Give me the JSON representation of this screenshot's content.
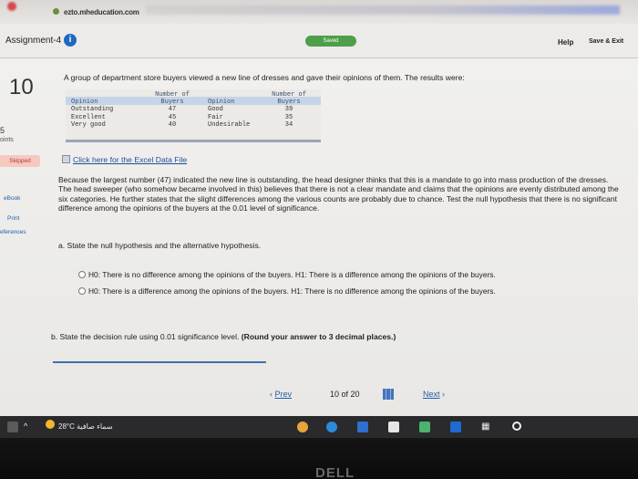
{
  "browser": {
    "url": "ezto.mheducation.com"
  },
  "header": {
    "title": "Assignment-4",
    "saved": "Saved",
    "help": "Help",
    "save_exit": "Save & Exit"
  },
  "question": {
    "number": "10",
    "points_value": "5",
    "points_label": "oints",
    "status": "Skipped",
    "side_links": [
      "eBook",
      "Print",
      "eferences"
    ],
    "prompt": "A group of department store buyers viewed a new line of dresses and gave their opinions of them. The results were:",
    "table": {
      "col1_header": "Opinion",
      "col2_header_line1": "Number of",
      "col2_header_line2": "Buyers",
      "col3_header": "Opinion",
      "col4_header_line1": "Number of",
      "col4_header_line2": "Buyers",
      "rows": [
        {
          "op1": "Outstanding",
          "n1": "47",
          "op2": "Good",
          "n2": "39"
        },
        {
          "op1": "Excellent",
          "n1": "45",
          "op2": "Fair",
          "n2": "35"
        },
        {
          "op1": "Very good",
          "n1": "40",
          "op2": "Undesirable",
          "n2": "34"
        }
      ]
    },
    "excel_link": "Click here for the Excel Data File",
    "paragraph": "Because the largest number (47) indicated the new line is outstanding, the head designer thinks that this is a mandate to go into mass production of the dresses. The head sweeper (who somehow became involved in this) believes that there is not a clear mandate and claims that the opinions are evenly distributed among the six categories. He further states that the slight differences among the various counts are probably due to chance. Test the null hypothesis that there is no significant difference among the opinions of the buyers at the 0.01 level of significance.",
    "part_a": "a. State the null hypothesis and the alternative hypothesis.",
    "options": [
      "H0: There is no difference among the opinions of the buyers. H1: There is a difference among the opinions of the buyers.",
      "H0: There is a difference among the opinions of the buyers. H1: There is no difference among the opinions of the buyers."
    ],
    "part_b_prefix": "b. State the decision rule using 0.01 significance level.",
    "part_b_bold": "(Round your answer to 3 decimal places.)"
  },
  "pager": {
    "prev": "Prev",
    "count": "10 of 20",
    "next": "Next"
  },
  "taskbar": {
    "weather": "28°C  سماء صافية"
  },
  "bezel": {
    "logo": "DELL"
  }
}
